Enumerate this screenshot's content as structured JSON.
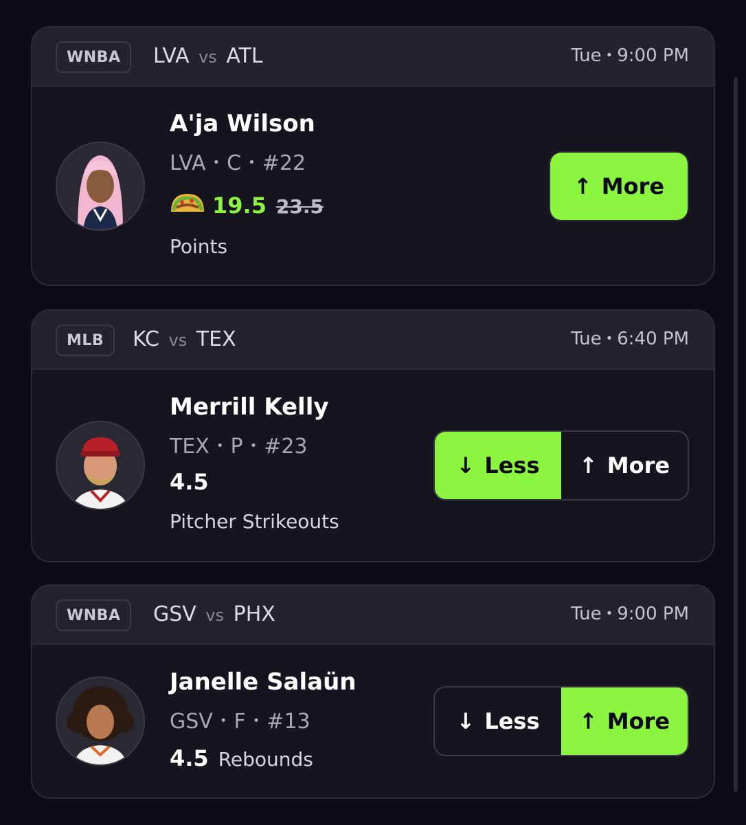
{
  "cards": [
    {
      "league": "WNBA",
      "home": "LVA",
      "vs": "vs",
      "away": "ATL",
      "day": "Tue",
      "time": "9:00 PM",
      "player": "A'ja Wilson",
      "team": "LVA",
      "position": "C",
      "number": "#22",
      "line": "19.5",
      "old_line": "23.5",
      "stat": "Points",
      "promo_icon": "taco-icon",
      "buttons": {
        "more": "More"
      },
      "selected": "more",
      "accent": "#8cf53f"
    },
    {
      "league": "MLB",
      "home": "KC",
      "vs": "vs",
      "away": "TEX",
      "day": "Tue",
      "time": "6:40 PM",
      "player": "Merrill Kelly",
      "team": "TEX",
      "position": "P",
      "number": "#23",
      "line": "4.5",
      "stat": "Pitcher Strikeouts",
      "buttons": {
        "less": "Less",
        "more": "More"
      },
      "selected": "less"
    },
    {
      "league": "WNBA",
      "home": "GSV",
      "vs": "vs",
      "away": "PHX",
      "day": "Tue",
      "time": "9:00 PM",
      "player": "Janelle Salaün",
      "team": "GSV",
      "position": "F",
      "number": "#13",
      "line": "4.5",
      "stat": "Rebounds",
      "buttons": {
        "less": "Less",
        "more": "More"
      },
      "selected": "more"
    }
  ],
  "separator": "•"
}
